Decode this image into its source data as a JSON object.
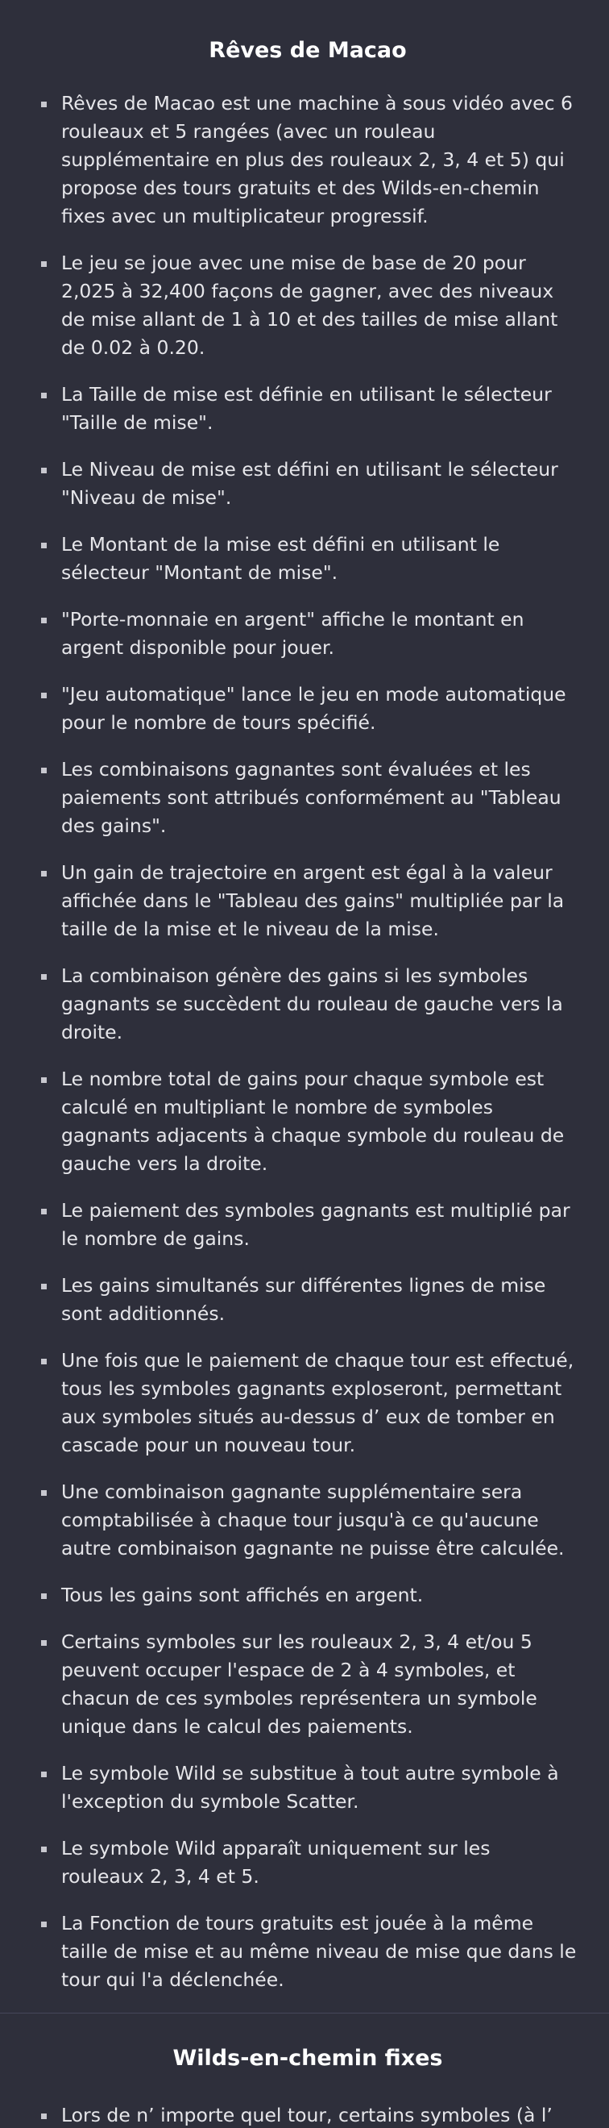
{
  "sections": [
    {
      "title": "Rêves de Macao",
      "items": [
        "Rêves de Macao est une machine à sous vidéo avec 6 rouleaux et 5 rangées (avec un rouleau supplémentaire en plus des rouleaux 2, 3, 4 et 5) qui propose des tours gratuits et des Wilds-en-chemin fixes avec un multiplicateur progressif.",
        "Le jeu se joue avec une mise de base de 20 pour 2,025 à 32,400 façons de gagner, avec des niveaux de mise allant de 1 à 10 et des tailles de mise allant de 0.02 à 0.20.",
        "La Taille de mise est définie en utilisant le sélecteur \"Taille de mise\".",
        "Le Niveau de mise est défini en utilisant le sélecteur \"Niveau de mise\".",
        "Le Montant de la mise est défini en utilisant le sélecteur \"Montant de mise\".",
        "\"Porte-monnaie en argent\" affiche le montant en argent disponible pour jouer.",
        "\"Jeu automatique\" lance le jeu en mode automatique pour le nombre de tours spécifié.",
        "Les combinaisons gagnantes sont évaluées et les paiements sont attribués conformément au \"Tableau des gains\".",
        "Un gain de trajectoire en argent est égal à la valeur affichée dans le \"Tableau des gains\" multipliée par la taille de la mise et le niveau de la mise.",
        "La combinaison génère des gains si les symboles gagnants se succèdent du rouleau de gauche vers la droite.",
        "Le nombre total de gains pour chaque symbole est calculé en multipliant le nombre de symboles gagnants adjacents à chaque symbole du rouleau de gauche vers la droite.",
        "Le paiement des symboles gagnants est multiplié par le nombre de gains.",
        "Les gains simultanés sur différentes lignes de mise sont additionnés.",
        "Une fois que le paiement de chaque tour est effectué, tous les symboles gagnants exploseront, permettant aux symboles situés au-dessus d’ eux de tomber en cascade pour un nouveau tour.",
        "Une combinaison gagnante supplémentaire sera comptabilisée à chaque tour jusqu'à ce qu'aucune autre combinaison gagnante ne puisse être calculée.",
        "Tous les gains sont affichés en argent.",
        "Certains symboles sur les rouleaux 2, 3, 4 et/ou 5 peuvent occuper l'espace de 2 à 4 symboles, et chacun de ces symboles représentera un symbole unique dans le calcul des paiements.",
        "Le symbole Wild se substitue à tout autre symbole à l'exception du symbole Scatter.",
        "Le symbole Wild apparaît uniquement sur les rouleaux 2, 3, 4 et 5.",
        "La Fonction de tours gratuits est jouée à la même taille de mise et au même niveau de mise que dans le tour qui l'a déclenchée."
      ]
    },
    {
      "title": "Wilds-en-chemin fixes",
      "items": [
        "Lors de n’ importe quel tour, certains symboles (à l’ exception des symboles Wild et Scatter) sur les"
      ]
    }
  ]
}
